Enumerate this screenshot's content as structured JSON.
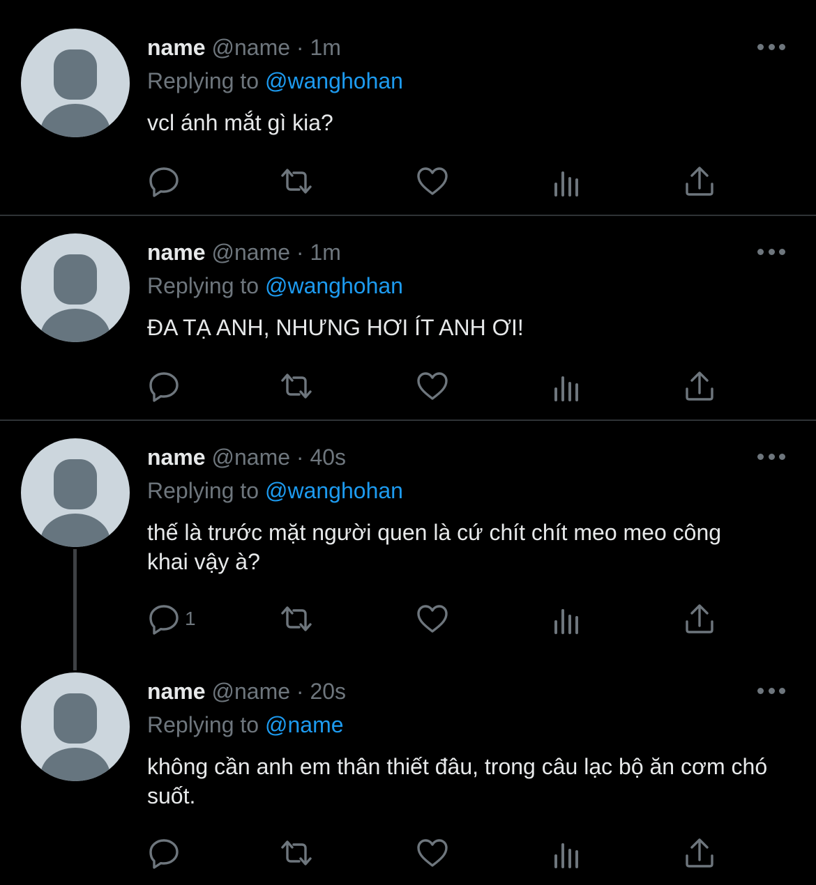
{
  "colors": {
    "background": "#000000",
    "text": "#e7e9ea",
    "muted": "#6e767d",
    "accent": "#1d9bf0",
    "divider": "#2f3336"
  },
  "icons": [
    "default-avatar-icon",
    "more-options-icon",
    "reply-icon",
    "retweet-icon",
    "like-icon",
    "analytics-icon",
    "share-icon"
  ],
  "tweets": [
    {
      "display_name": "name",
      "handle": "@name",
      "separator": "·",
      "time": "1m",
      "replying_prefix": "Replying to",
      "replying_to": "@wanghohan",
      "text": "vcl ánh mắt gì kia?",
      "reply_count": ""
    },
    {
      "display_name": "name",
      "handle": "@name",
      "separator": "·",
      "time": "1m",
      "replying_prefix": "Replying to",
      "replying_to": "@wanghohan",
      "text": "ĐA TẠ ANH, NHƯNG HƠI ÍT ANH ƠI!",
      "reply_count": ""
    },
    {
      "display_name": "name",
      "handle": "@name",
      "separator": "·",
      "time": "40s",
      "replying_prefix": "Replying to",
      "replying_to": "@wanghohan",
      "text": "thế là trước mặt người quen là cứ chít chít meo meo công khai vậy à?",
      "reply_count": "1"
    },
    {
      "display_name": "name",
      "handle": "@name",
      "separator": "·",
      "time": "20s",
      "replying_prefix": "Replying to",
      "replying_to": "@name",
      "text": "không cần anh em thân thiết đâu, trong câu lạc bộ ăn cơm chó suốt.",
      "reply_count": ""
    }
  ]
}
